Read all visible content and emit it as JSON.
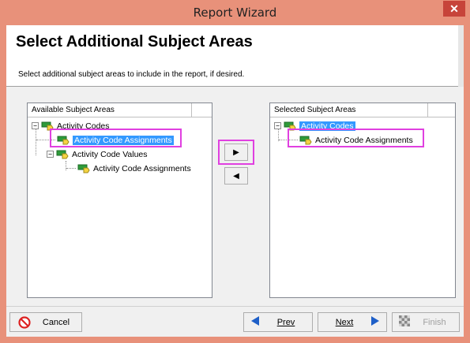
{
  "window": {
    "title": "Report Wizard"
  },
  "header": {
    "title": "Select Additional Subject Areas",
    "description": "Select additional subject areas to include in the report, if desired."
  },
  "available": {
    "column_header": "Available Subject Areas",
    "items": [
      {
        "label": "Activity Codes",
        "expander": "−"
      },
      {
        "label": "Activity Code Assignments",
        "selected": true
      },
      {
        "label": "Activity Code Values",
        "expander": "−"
      },
      {
        "label": "Activity Code Assignments"
      }
    ]
  },
  "selected": {
    "column_header": "Selected Subject Areas",
    "items": [
      {
        "label": "Activity Codes",
        "expander": "−",
        "selected": true
      },
      {
        "label": "Activity Code Assignments"
      }
    ]
  },
  "move": {
    "add_glyph": "▶",
    "remove_glyph": "◀"
  },
  "footer": {
    "cancel_label": "Cancel",
    "prev_label": "Prev",
    "next_label": "Next",
    "finish_label": "Finish"
  },
  "icons": {
    "close": "close-icon",
    "node": "subject-area-icon",
    "cancel": "cancel-icon",
    "prev": "arrow-left-icon",
    "next": "arrow-right-icon",
    "finish": "finish-icon"
  },
  "colors": {
    "frame": "#e8917a",
    "selection": "#3399ff",
    "highlight": "#e040e0",
    "arrow": "#1e5fc8"
  }
}
